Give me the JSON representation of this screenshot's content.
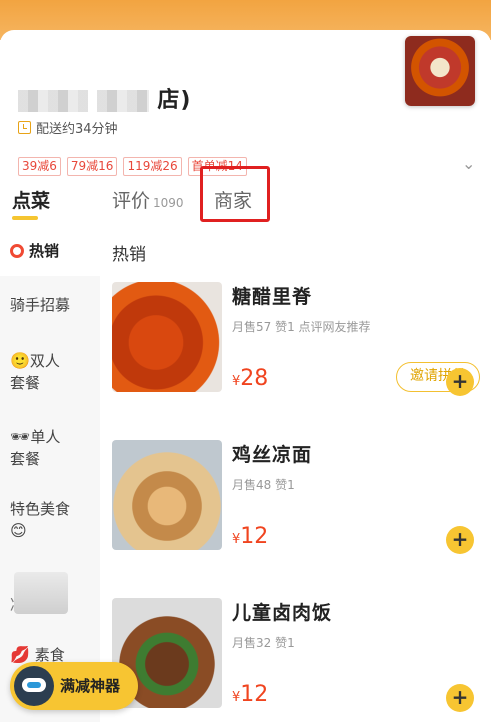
{
  "header": {
    "shop_name_suffix": "店)",
    "delivery_text": "配送约34分钟",
    "promos": [
      "39减6",
      "79减16",
      "119减26",
      "首单减14"
    ]
  },
  "tabs": {
    "order": "点菜",
    "reviews": "评价",
    "reviews_count": "1090",
    "merchant": "商家",
    "invite_button": "邀请拼单"
  },
  "sidebar": {
    "items": [
      "热销",
      "骑手招募",
      "双人\n套餐",
      "单人\n套餐",
      "特色美食",
      "凉菜",
      "素食"
    ]
  },
  "section_title": "热销",
  "dishes": [
    {
      "name": "糖醋里脊",
      "meta": "月售57   赞1   点评网友推荐",
      "currency": "¥",
      "price": "28"
    },
    {
      "name": "鸡丝凉面",
      "meta": "月售48   赞1",
      "currency": "¥",
      "price": "12"
    },
    {
      "name": "儿童卤肉饭",
      "meta": "月售32   赞1",
      "currency": "¥",
      "price": "12"
    }
  ],
  "promo_tool": {
    "label": "满减神器"
  },
  "colors": {
    "accent": "#f7c532",
    "price": "#f0441f",
    "highlight": "#e02020"
  }
}
